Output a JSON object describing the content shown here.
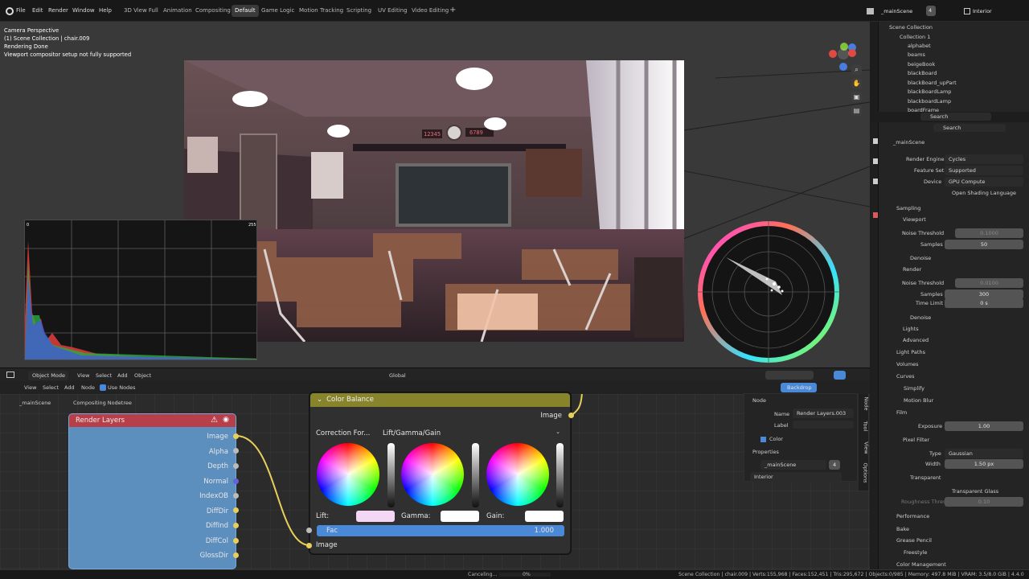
{
  "menu": [
    "File",
    "Edit",
    "Render",
    "Window",
    "Help"
  ],
  "workspaces": [
    "3D View Full",
    "Animation",
    "Compositing",
    "Default",
    "Game Logic",
    "Motion Tracking",
    "Scripting",
    "UV Editing",
    "Video Editing"
  ],
  "active_workspace": "Default",
  "scene": {
    "name": "_mainScene",
    "users": "4",
    "view_layer": "Interior"
  },
  "viewport_text": [
    "Camera Perspective",
    "(1) Scene Collection | chair.009",
    "Rendering Done",
    "Viewport compositor setup not fully supported"
  ],
  "histogram": {
    "min": "0",
    "max": "255"
  },
  "board": {
    "left_number": "12345",
    "right_number": "6789"
  },
  "view_header": {
    "mode": "Object Mode",
    "items": [
      "View",
      "Select",
      "Add",
      "Object"
    ],
    "transform": "Global"
  },
  "node_header": {
    "items": [
      "View",
      "Select",
      "Add",
      "Node"
    ],
    "use_nodes": "Use Nodes",
    "backdrop": "Backdrop",
    "scene": "_mainScene",
    "tree": "Compositing Nodetree"
  },
  "render_node": {
    "title": "Render Layers",
    "outputs": [
      "Image",
      "Alpha",
      "Depth",
      "Normal",
      "IndexOB",
      "DiffDir",
      "DiffInd",
      "DiffCol",
      "GlossDir"
    ]
  },
  "color_node": {
    "title": "Color Balance",
    "output": "Image",
    "correction_label": "Correction For...",
    "correction_value": "Lift/Gamma/Gain",
    "labels": [
      "Lift:",
      "Gamma:",
      "Gain:"
    ],
    "fac_label": "Fac",
    "fac_value": "1.000",
    "input": "Image"
  },
  "node_props": {
    "node": "Node",
    "name_label": "Name",
    "name": "Render Layers.003",
    "label_label": "Label",
    "color": "Color",
    "properties": "Properties",
    "scene": "_mainScene",
    "scene_users": "4",
    "view_layer": "Interior",
    "tabs": [
      "Node",
      "Tool",
      "View",
      "Options"
    ]
  },
  "outliner": {
    "root": "Scene Collection",
    "collection": "Collection 1",
    "items": [
      "alphabet",
      "beams",
      "beigeBook",
      "blackBoard",
      "blackBoard_upPart",
      "blackBoardLamp",
      "blackboardLamp",
      "boardFrame"
    ]
  },
  "search": "Search",
  "props": {
    "scene": "_mainScene",
    "render_engine_label": "Render Engine",
    "render_engine": "Cycles",
    "feature_set_label": "Feature Set",
    "feature_set": "Supported",
    "device_label": "Device",
    "device": "GPU Compute",
    "osl": "Open Shading Language",
    "sampling": "Sampling",
    "viewport": "Viewport",
    "noise_threshold": "Noise Threshold",
    "viewport_noise": "0.1000",
    "samples": "Samples",
    "viewport_samples": "50",
    "denoise": "Denoise",
    "render": "Render",
    "render_noise": "0.0100",
    "render_samples": "300",
    "time_limit": "Time Limit",
    "time_value": "0 s",
    "light_paths": "Light Paths",
    "lights": "Lights",
    "advanced": "Advanced",
    "volumes": "Volumes",
    "curves": "Curves",
    "simplify": "Simplify",
    "motion_blur": "Motion Blur",
    "film": "Film",
    "exposure_label": "Exposure",
    "exposure": "1.00",
    "pixel_filter": "Pixel Filter",
    "type_label": "Type",
    "type": "Gaussian",
    "width_label": "Width",
    "width": "1.50 px",
    "transparent": "Transparent",
    "transparent_glass": "Transparent Glass",
    "roughness": "Roughness Thresh...",
    "roughness_value": "0.10",
    "performance": "Performance",
    "bake": "Bake",
    "grease": "Grease Pencil",
    "freestyle": "Freestyle",
    "color_management": "Color Management"
  },
  "status": {
    "canceling": "Canceling...",
    "percent": "0%",
    "stats": "Scene Collection | chair.009 | Verts:155,968 | Faces:152,451 | Tris:295,672 | Objects:0/985 | Memory: 497.8 MiB | VRAM: 3.5/8.0 GiB | 4.4.0"
  },
  "colors": {
    "accent": "#4a88d8",
    "render_node": "#5c8ebe",
    "color_node": "#88842c",
    "active": "#e6d05b"
  }
}
